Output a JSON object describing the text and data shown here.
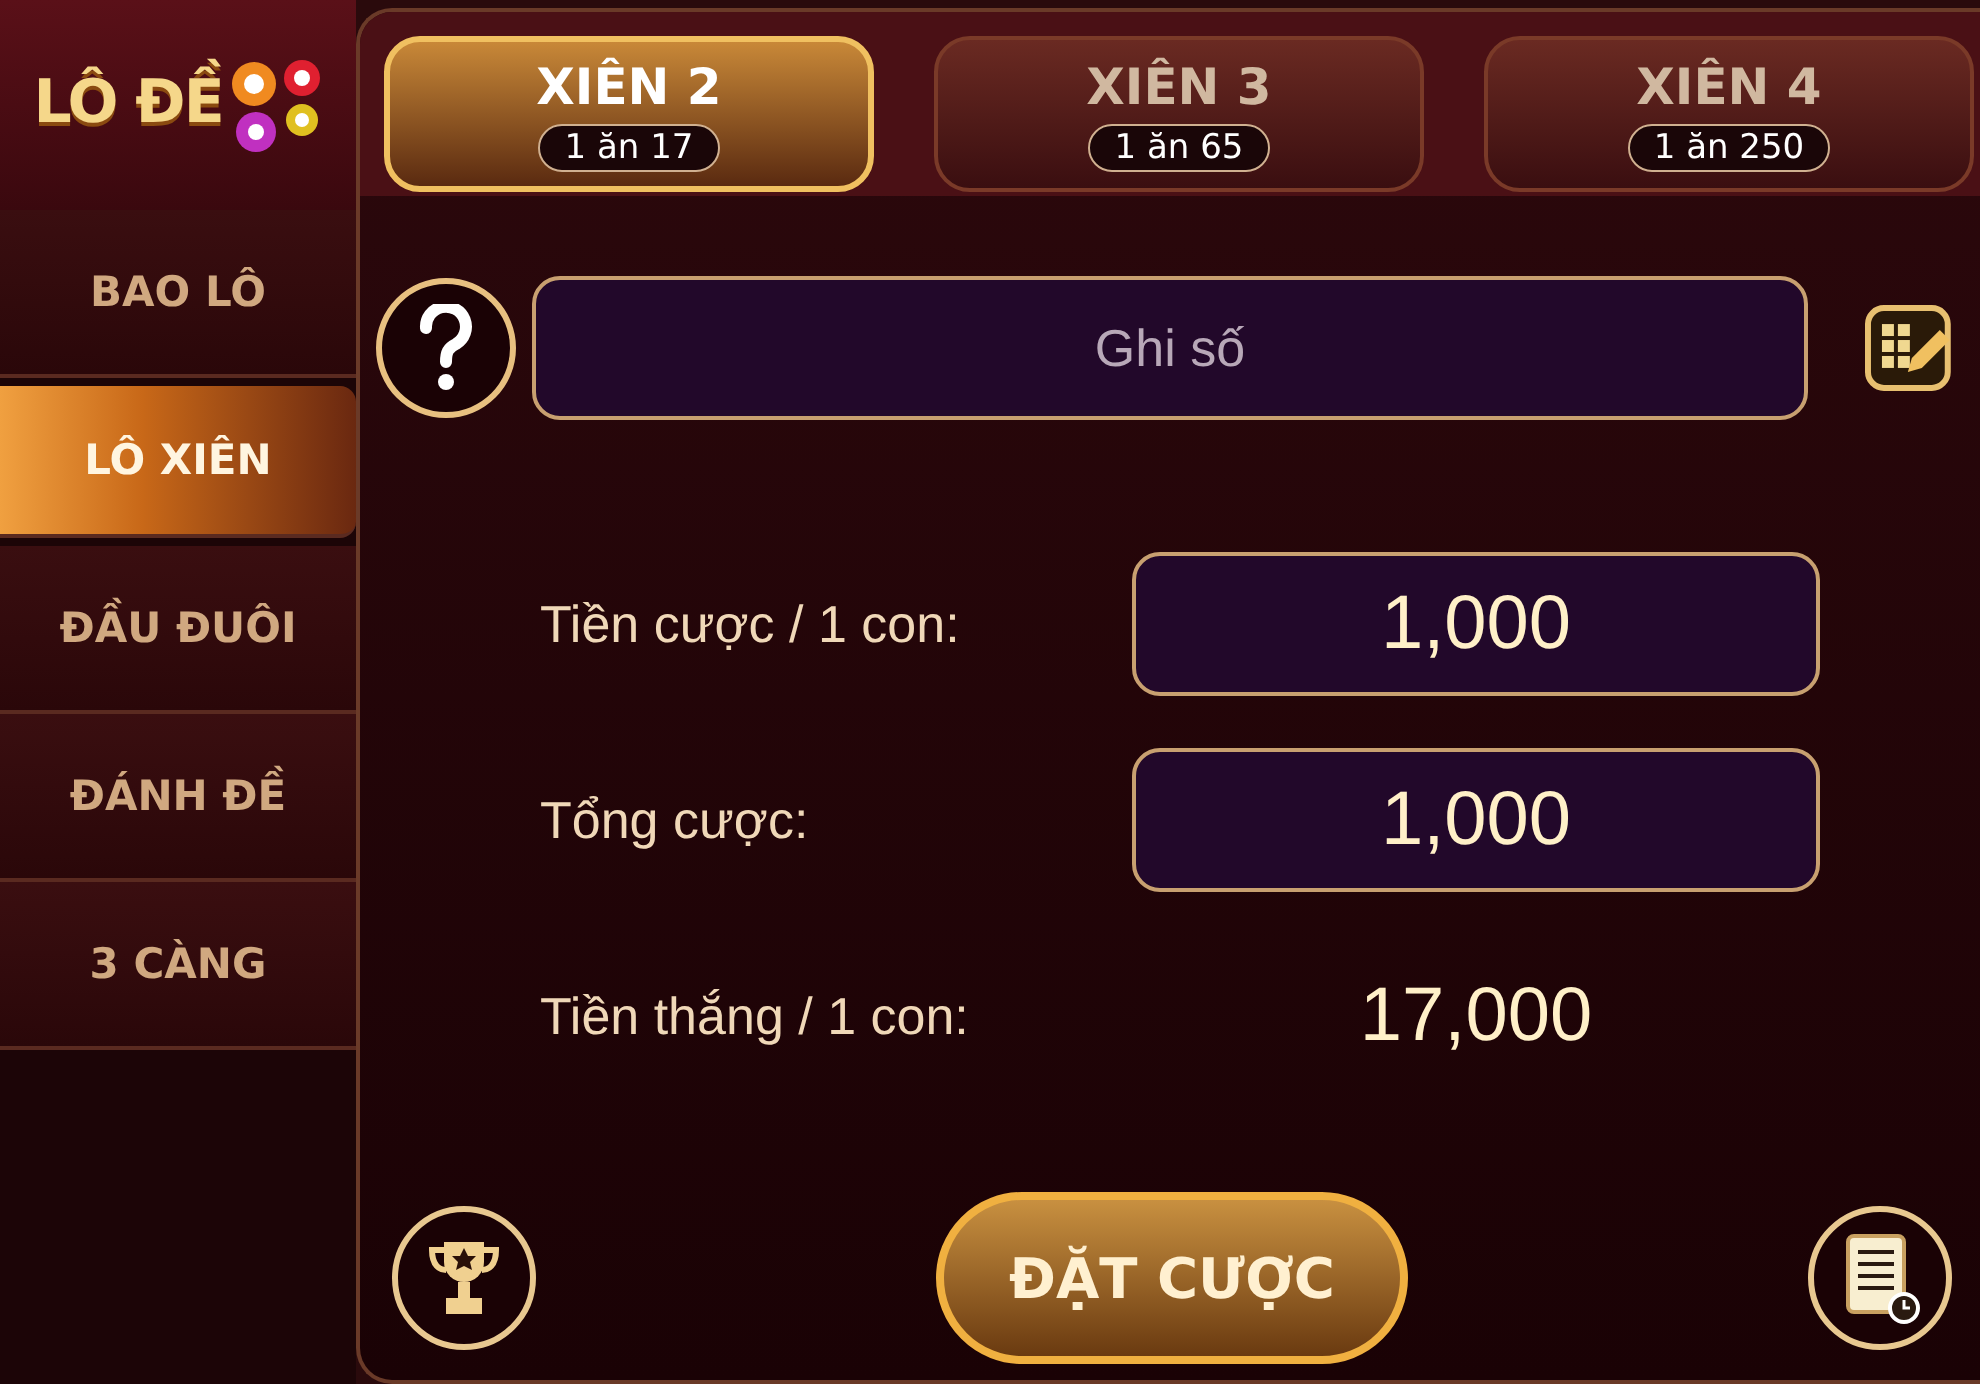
{
  "logo": {
    "text": "LÔ ĐỀ"
  },
  "tabs": [
    {
      "label": "XIÊN 2",
      "odds": "1 ăn 17",
      "selected": true
    },
    {
      "label": "XIÊN 3",
      "odds": "1 ăn 65",
      "selected": false
    },
    {
      "label": "XIÊN 4",
      "odds": "1 ăn 250",
      "selected": false
    }
  ],
  "sidebar": {
    "items": [
      {
        "label": "BAO LÔ",
        "selected": false
      },
      {
        "label": "LÔ XIÊN",
        "selected": true
      },
      {
        "label": "ĐẦU ĐUÔI",
        "selected": false
      },
      {
        "label": "ĐÁNH ĐỀ",
        "selected": false
      },
      {
        "label": "3 CÀNG",
        "selected": false
      }
    ]
  },
  "number_field": {
    "placeholder": "Ghi số"
  },
  "rows": [
    {
      "kind": "field",
      "label": "Tiền cược / 1 con:",
      "value": "1,000"
    },
    {
      "kind": "field",
      "label": "Tổng cược:",
      "value": "1,000"
    },
    {
      "kind": "text",
      "label": "Tiền thắng / 1 con:",
      "value": "17,000"
    }
  ],
  "bet_button": {
    "label": "ĐẶT CƯỢC"
  }
}
